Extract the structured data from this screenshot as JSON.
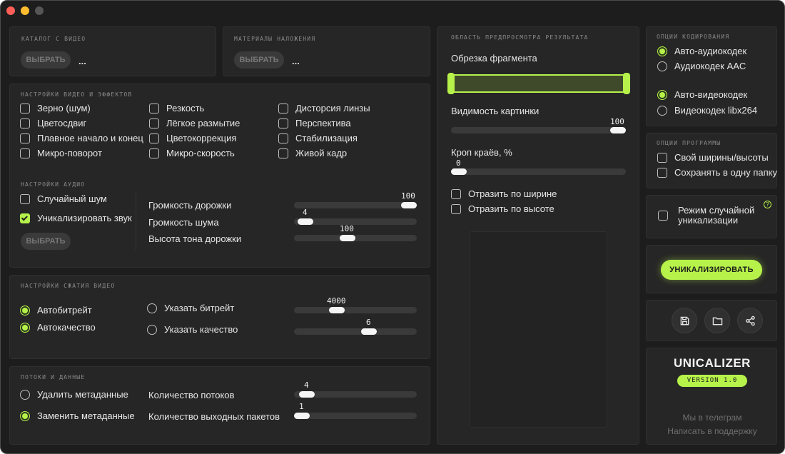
{
  "catalog": {
    "title": "КАТАЛОГ С ВИДЕО",
    "button": "ВЫБРАТЬ",
    "path": "..."
  },
  "overlays": {
    "title": "МАТЕРИАЛЫ НАЛОЖЕНИЯ",
    "button": "ВЫБРАТЬ",
    "path": "..."
  },
  "video_effects": {
    "title": "НАСТРОЙКИ ВИДЕО И ЭФФЕКТОВ",
    "items": [
      {
        "label": "Зерно (шум)",
        "checked": false
      },
      {
        "label": "Цветосдвиг",
        "checked": false
      },
      {
        "label": "Плавное начало и конец",
        "checked": false
      },
      {
        "label": "Микро-поворот",
        "checked": false
      },
      {
        "label": "Резкость",
        "checked": false
      },
      {
        "label": "Лёгкое размытие",
        "checked": false
      },
      {
        "label": "Цветокоррекция",
        "checked": false
      },
      {
        "label": "Микро-скорость",
        "checked": false
      },
      {
        "label": "Дисторсия линзы",
        "checked": false
      },
      {
        "label": "Перспектива",
        "checked": false
      },
      {
        "label": "Стабилизация",
        "checked": false
      },
      {
        "label": "Живой кадр",
        "checked": false
      }
    ]
  },
  "audio": {
    "title": "НАСТРОЙКИ АУДИО",
    "random_noise": {
      "label": "Случайный шум",
      "checked": false
    },
    "unique_sound": {
      "label": "Уникализировать звук",
      "checked": true
    },
    "button": "ВЫБРАТЬ",
    "sliders": [
      {
        "label": "Громкость дорожки",
        "value": "100",
        "fraction": 1.0
      },
      {
        "label": "Громкость шума",
        "value": "4",
        "fraction": 0.04
      },
      {
        "label": "Высота тона дорожки",
        "value": "100",
        "fraction": 0.5
      }
    ]
  },
  "compression": {
    "title": "НАСТРОЙКИ СЖАТИЯ ВИДЕО",
    "auto_bitrate": {
      "label": "Автобитрейт",
      "selected": true
    },
    "auto_quality": {
      "label": "Автокачество",
      "selected": true
    },
    "set_bitrate": {
      "label": "Указать битрейт",
      "selected": false,
      "value": "4000",
      "fraction": 0.35
    },
    "set_quality": {
      "label": "Указать качество",
      "selected": false,
      "value": "6",
      "fraction": 0.6
    }
  },
  "streams": {
    "title": "ПОТОКИ И ДАННЫЕ",
    "delete_meta": {
      "label": "Удалить метаданные",
      "selected": false
    },
    "replace_meta": {
      "label": "Заменить метаданные",
      "selected": true
    },
    "threads": {
      "label": "Количество потоков",
      "value": "4",
      "fraction": 0.05
    },
    "packets": {
      "label": "Количество выходных пакетов",
      "value": "1",
      "fraction": 0.0
    }
  },
  "preview": {
    "title": "ОБЛАСТЬ ПРЕДПРОСМОТРА РЕЗУЛЬТАТА",
    "trim_label": "Обрезка фрагмента",
    "visibility": {
      "label": "Видимость картинки",
      "value": "100",
      "fraction": 1.0
    },
    "crop": {
      "label": "Кроп краёв, %",
      "value": "0",
      "fraction": 0.0
    },
    "flip_h": {
      "label": "Отразить по ширине",
      "checked": false
    },
    "flip_v": {
      "label": "Отразить по высоте",
      "checked": false
    }
  },
  "encoding": {
    "title": "ОПЦИИ КОДИРОВАНИЯ",
    "audio_auto": {
      "label": "Авто-аудиокодек",
      "selected": true
    },
    "audio_aac": {
      "label": "Аудиокодек AAC",
      "selected": false
    },
    "video_auto": {
      "label": "Авто-видеокодек",
      "selected": true
    },
    "video_x264": {
      "label": "Видеокодек libx264",
      "selected": false
    }
  },
  "program": {
    "title": "ОПЦИИ ПРОГРАММЫ",
    "own_size": {
      "label": "Свой ширины/высоты",
      "checked": false
    },
    "one_folder": {
      "label": "Сохранять в одну папку",
      "checked": false
    }
  },
  "random_mode": {
    "label_line1": "Режим случайной",
    "label_line2": "уникализации",
    "checked": false,
    "help": "?"
  },
  "actions": {
    "unique_button": "УНИКАЛИЗИРОВАТЬ"
  },
  "brand": {
    "name": "UNICALIZER",
    "version": "VERSION 1.0",
    "telegram": "Мы в телеграм",
    "support": "Написать в поддержку"
  },
  "colors": {
    "accent": "#b6f24a",
    "panel": "#262626",
    "background": "#1d1d1d"
  },
  "icons": [
    "save-icon",
    "folder-icon",
    "share-icon",
    "help-icon"
  ]
}
